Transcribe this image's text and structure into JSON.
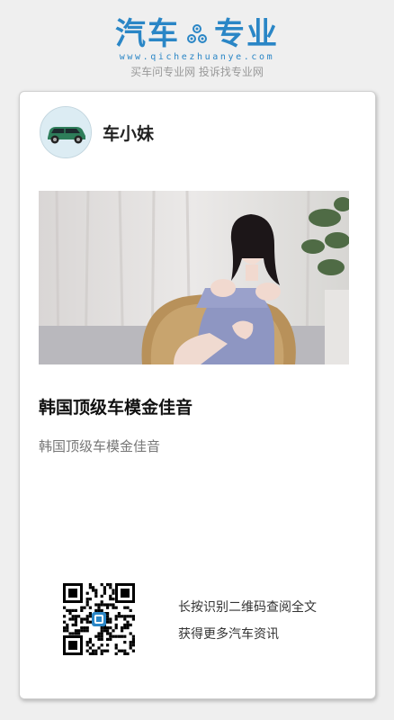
{
  "header": {
    "logo_left": "汽车",
    "logo_right": "专业",
    "domain": "www.qichezhuanye.com",
    "tagline": "买车问专业网 投诉找专业网"
  },
  "post": {
    "author": "车小妹",
    "title": "韩国顶级车模金佳音",
    "description": "韩国顶级车模金佳音"
  },
  "footer": {
    "qr_line1": "长按识别二维码查阅全文",
    "qr_line2": "获得更多汽车资讯"
  },
  "colors": {
    "brand": "#2a86c6",
    "background": "#efefef",
    "card": "#ffffff"
  }
}
